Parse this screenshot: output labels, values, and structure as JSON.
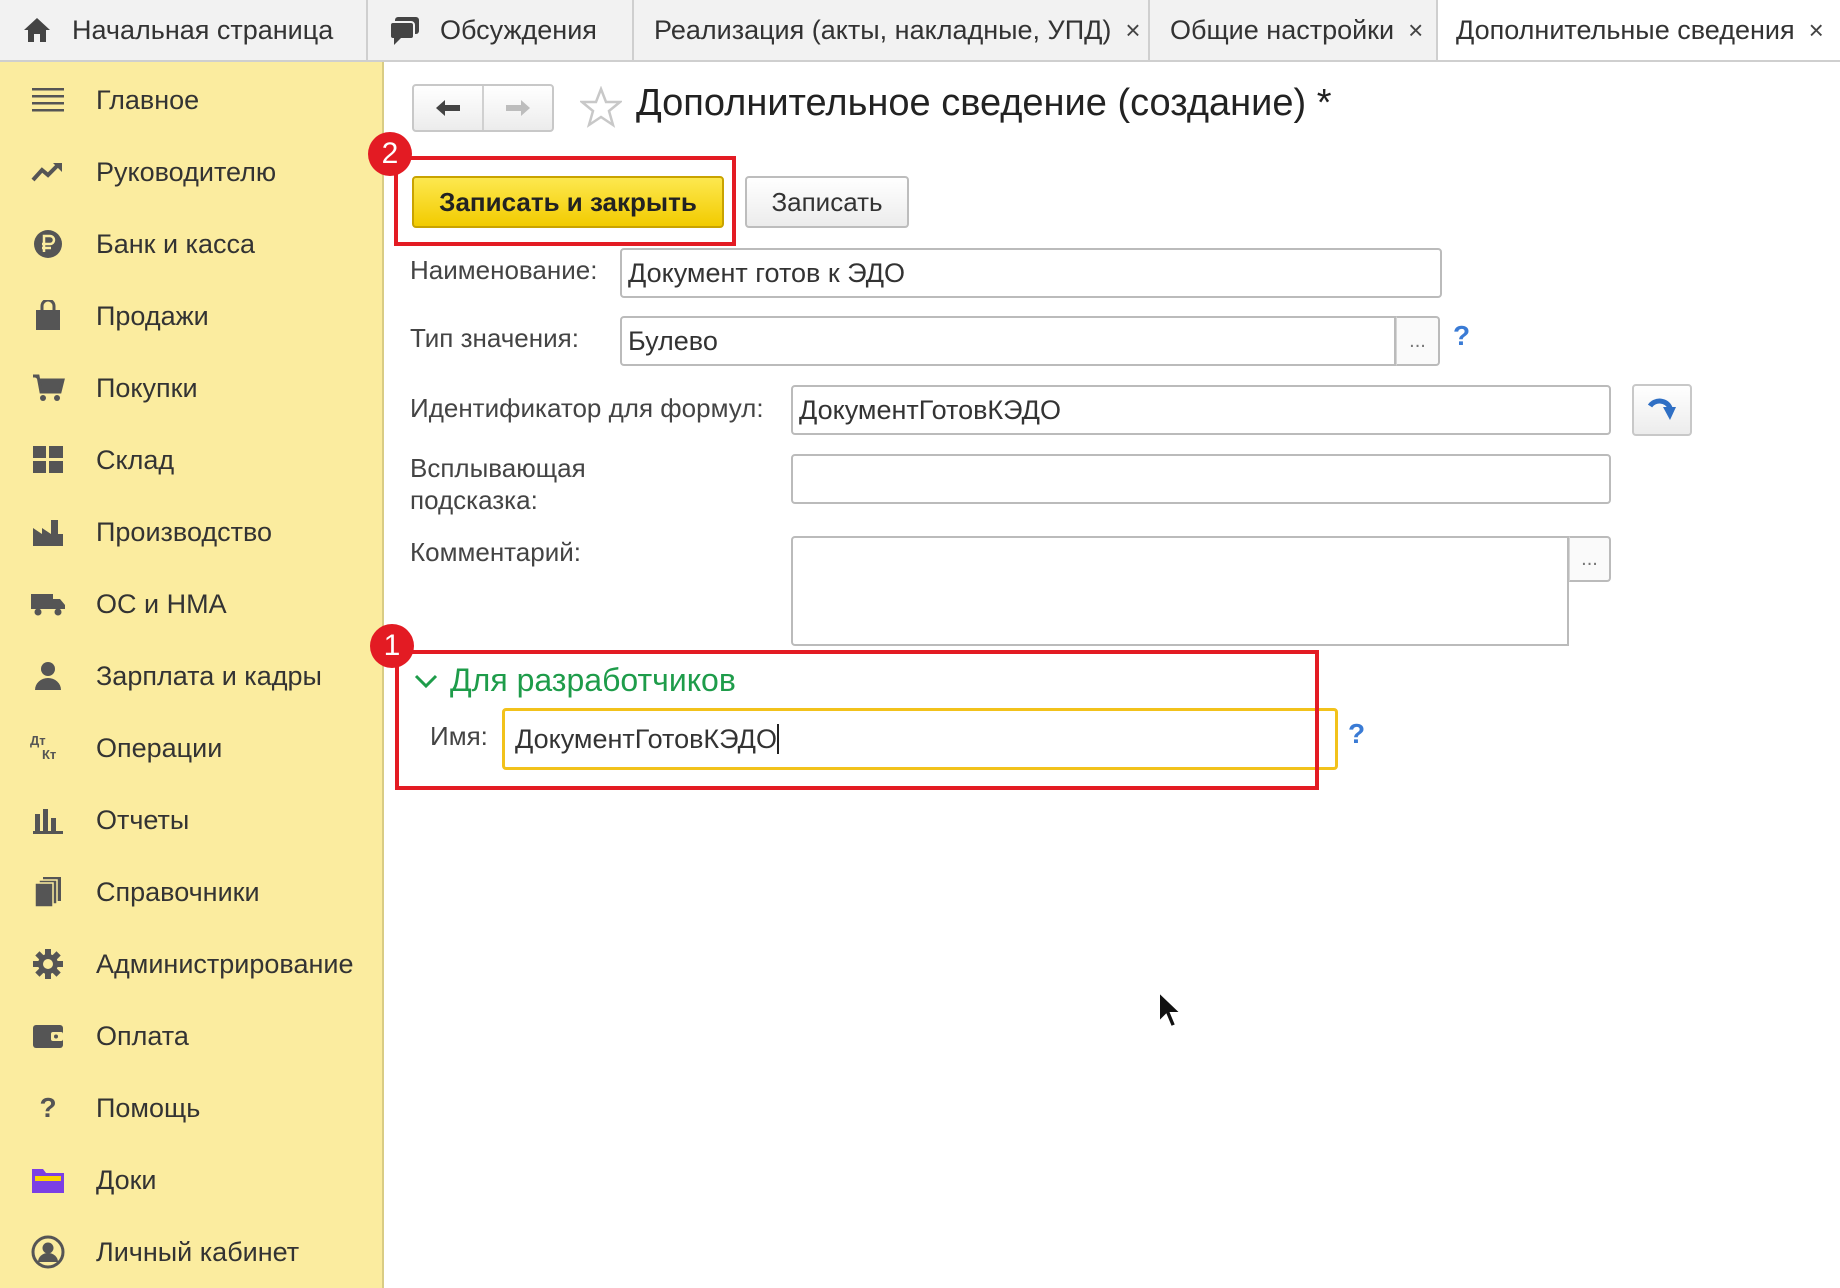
{
  "tabs": [
    {
      "label": "Начальная страница",
      "closable": false
    },
    {
      "label": "Обсуждения",
      "closable": false
    },
    {
      "label": "Реализация (акты, накладные, УПД)",
      "closable": true
    },
    {
      "label": "Общие настройки",
      "closable": true
    },
    {
      "label": "Дополнительные сведения",
      "closable": true
    }
  ],
  "tab_close_glyph": "×",
  "sidebar": {
    "items": [
      {
        "label": "Главное",
        "icon": "menu-icon"
      },
      {
        "label": "Руководителю",
        "icon": "trend-icon"
      },
      {
        "label": "Банк и касса",
        "icon": "ruble-coin-icon"
      },
      {
        "label": "Продажи",
        "icon": "shopping-bag-icon"
      },
      {
        "label": "Покупки",
        "icon": "cart-icon"
      },
      {
        "label": "Склад",
        "icon": "warehouse-icon"
      },
      {
        "label": "Производство",
        "icon": "factory-icon"
      },
      {
        "label": "ОС и НМА",
        "icon": "truck-icon"
      },
      {
        "label": "Зарплата и кадры",
        "icon": "person-icon"
      },
      {
        "label": "Операции",
        "icon": "debit-credit-icon"
      },
      {
        "label": "Отчеты",
        "icon": "bar-chart-icon"
      },
      {
        "label": "Справочники",
        "icon": "books-icon"
      },
      {
        "label": "Администрирование",
        "icon": "gear-icon"
      },
      {
        "label": "Оплата",
        "icon": "wallet-icon"
      },
      {
        "label": "Помощь",
        "icon": "question-icon"
      },
      {
        "label": "Доки",
        "icon": "folder-icon"
      },
      {
        "label": "Личный кабинет",
        "icon": "user-circle-icon"
      }
    ],
    "dt_kt": {
      "dt": "Дт",
      "kt": "Кт"
    },
    "help_glyph": "?"
  },
  "form": {
    "title": "Дополнительное сведение (создание) *",
    "save_close_label": "Записать и закрыть",
    "save_label": "Записать",
    "name_label": "Наименование:",
    "name_value": "Документ готов к ЭДО",
    "type_label": "Тип значения:",
    "type_value": "Булево",
    "id_label": "Идентификатор для формул:",
    "id_value": "ДокументГотовКЭДО",
    "tooltip_label_line1": "Всплывающая",
    "tooltip_label_line2": "подсказка:",
    "tooltip_value": "",
    "comment_label": "Комментарий:",
    "comment_value": "",
    "dots": "...",
    "help": "?"
  },
  "dev_group": {
    "title": "Для разработчиков",
    "name_label": "Имя:",
    "name_value": "ДокументГотовКЭДО"
  },
  "annotations": {
    "badge1": "1",
    "badge2": "2"
  },
  "colors": {
    "sidebar_bg": "#fbec9f",
    "primary_button": "#f5d40f",
    "annotation_red": "#e31b23",
    "group_green": "#1e9c4a",
    "help_blue": "#3a7bd5",
    "focus_yellow": "#f2c21b"
  }
}
